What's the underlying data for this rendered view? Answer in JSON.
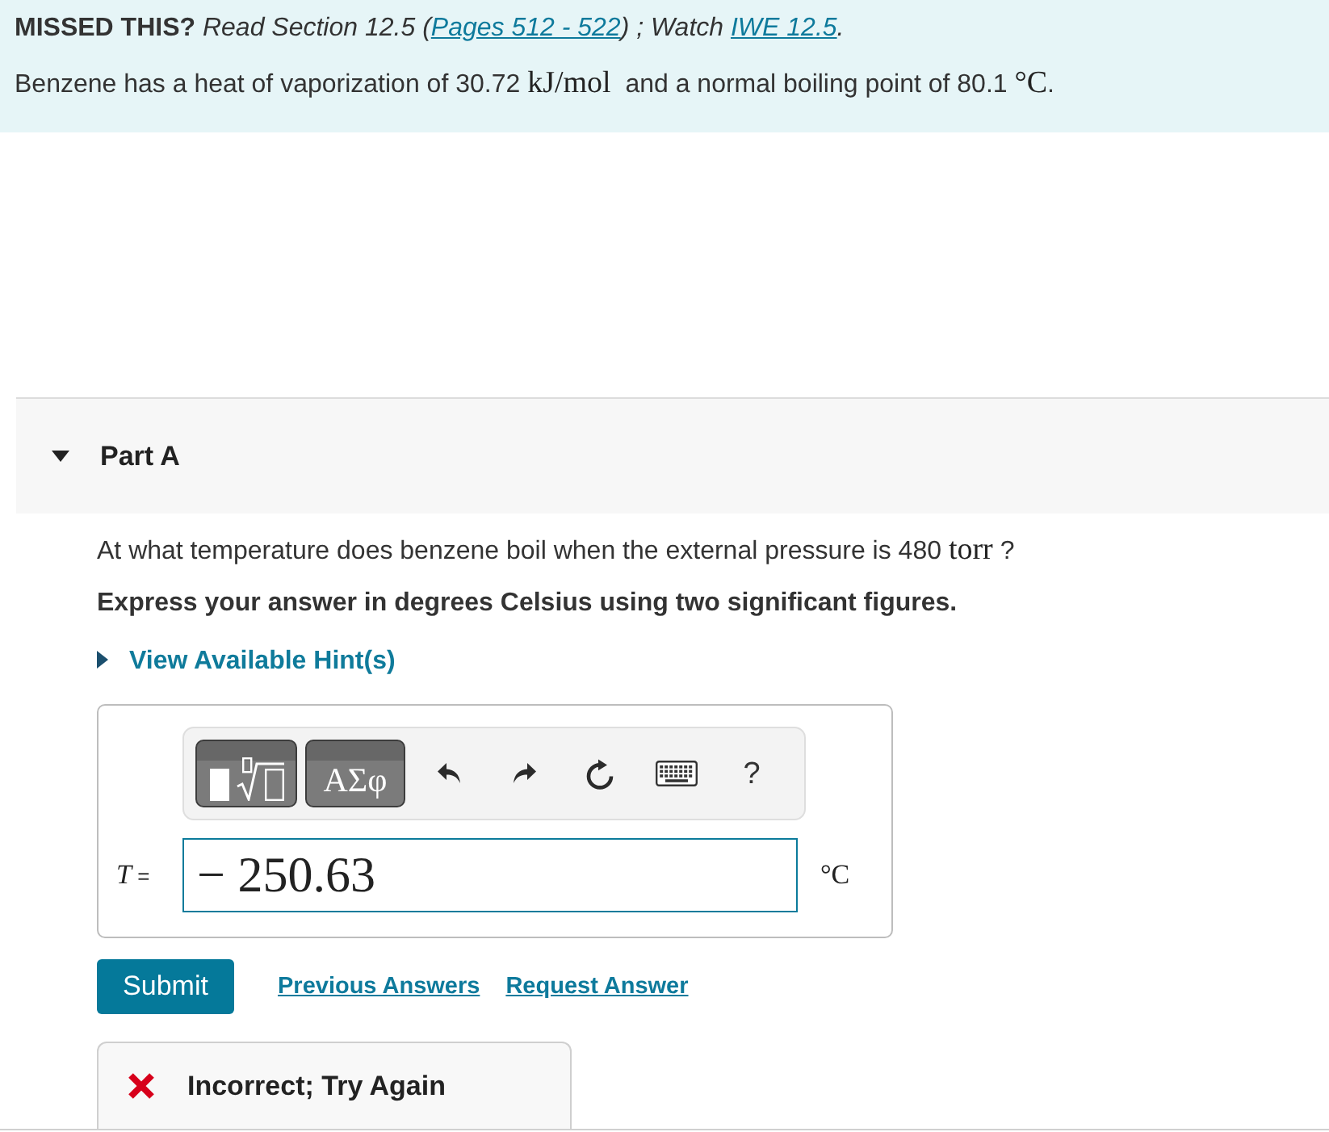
{
  "notice": {
    "label": "MISSED THIS?",
    "parts": [
      {
        "kind": "text",
        "text": "Read Section 12.5 ("
      },
      {
        "kind": "link",
        "text": "Pages 512 - 522"
      },
      {
        "kind": "text",
        "text": ") ; Watch "
      },
      {
        "kind": "link",
        "text": "IWE 12.5"
      },
      {
        "kind": "text",
        "text": "."
      }
    ]
  },
  "problem": {
    "parts": [
      {
        "kind": "text",
        "text": "Benzene has a heat of vaporization of 30.72 "
      },
      {
        "kind": "math",
        "text": "kJ/mol"
      },
      {
        "kind": "text",
        "text": "  and a normal boiling point of 80.1 "
      },
      {
        "kind": "math",
        "text": "°C"
      },
      {
        "kind": "text",
        "text": "."
      }
    ]
  },
  "part": {
    "title": "Part A",
    "expanded": true,
    "question": {
      "parts": [
        {
          "kind": "text",
          "text": "At what temperature does benzene boil when the external pressure is 480 "
        },
        {
          "kind": "math",
          "text": "torr"
        },
        {
          "kind": "text",
          "text": " ?"
        }
      ]
    },
    "instruction": "Express your answer in degrees Celsius using two significant figures.",
    "hint": {
      "label": "View Available Hint(s)",
      "expanded": false
    },
    "toolbar": [
      {
        "kind": "templates"
      },
      {
        "kind": "symbols",
        "label": "ΑΣφ"
      },
      {
        "kind": "undo"
      },
      {
        "kind": "redo"
      },
      {
        "kind": "reset"
      },
      {
        "kind": "keyboard"
      },
      {
        "kind": "help",
        "label": "?"
      }
    ],
    "answer": {
      "variable": "T",
      "equals": "=",
      "value": "− 250.63",
      "unit": "°C"
    },
    "actions": {
      "submit": "Submit",
      "links": [
        "Previous Answers",
        "Request Answer"
      ]
    },
    "feedback": {
      "kind": "incorrect",
      "text": "Incorrect; Try Again"
    }
  }
}
